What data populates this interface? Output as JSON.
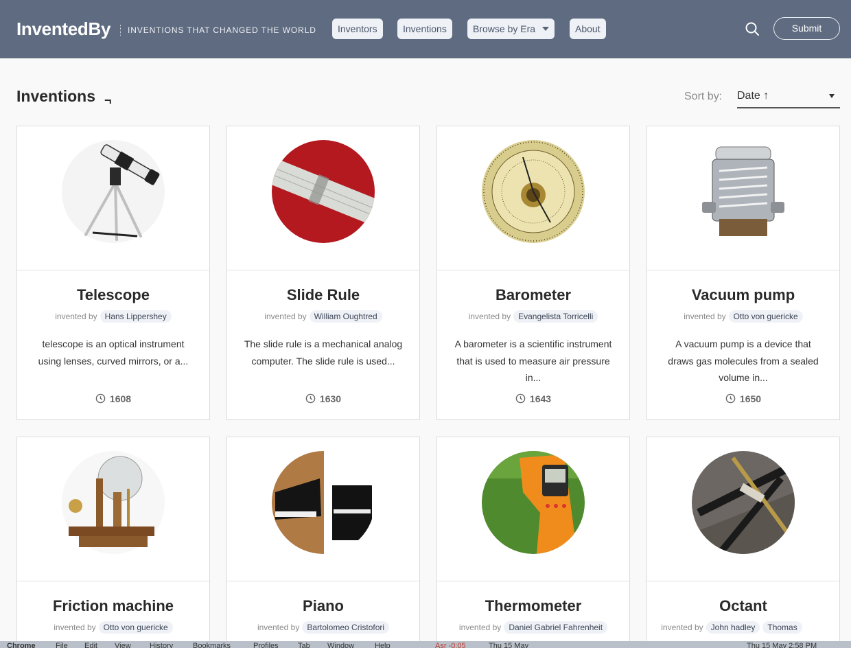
{
  "header": {
    "logo": "InventedBy",
    "tagline": "INVENTIONS THAT CHANGED THE WORLD",
    "nav": [
      "Inventors",
      "Inventions",
      "Browse by Era",
      "About"
    ],
    "search_icon": "search-icon",
    "submit_label": "Submit"
  },
  "main": {
    "title": "Inventions",
    "title_glyph": "¬",
    "sort_label": "Sort by:",
    "sort_value": "Date ↑"
  },
  "cards": [
    {
      "name": "Telescope",
      "by_label": "invented by",
      "inventors": [
        "Hans Lippershey"
      ],
      "desc": "telescope is an optical instrument using lenses, curved mirrors, or a...",
      "year": "1608",
      "image": "telescope-image"
    },
    {
      "name": "Slide Rule",
      "by_label": "invented by",
      "inventors": [
        "William Oughtred"
      ],
      "desc": "The slide rule is a mechanical analog computer. The slide rule is used...",
      "year": "1630",
      "image": "slide-rule-image"
    },
    {
      "name": "Barometer",
      "by_label": "invented by",
      "inventors": [
        "Evangelista Torricelli"
      ],
      "desc": "A barometer is a scientific instrument that is used to measure air pressure in...",
      "year": "1643",
      "image": "barometer-image"
    },
    {
      "name": "Vacuum pump",
      "by_label": "invented by",
      "inventors": [
        "Otto von guericke"
      ],
      "desc": "A vacuum pump is a device that draws gas molecules from a sealed volume in...",
      "year": "1650",
      "image": "vacuum-pump-image"
    },
    {
      "name": "Friction machine",
      "by_label": "invented by",
      "inventors": [
        "Otto von guericke"
      ],
      "image": "friction-machine-image"
    },
    {
      "name": "Piano",
      "by_label": "invented by",
      "inventors": [
        "Bartolomeo Cristofori"
      ],
      "image": "piano-image"
    },
    {
      "name": "Thermometer",
      "by_label": "invented by",
      "inventors": [
        "Daniel Gabriel Fahrenheit"
      ],
      "image": "thermometer-image"
    },
    {
      "name": "Octant",
      "by_label": "invented by",
      "inventors": [
        "John hadley",
        "Thomas"
      ],
      "image": "octant-image"
    }
  ],
  "os_menubar": {
    "items": [
      "Chrome",
      "File",
      "Edit",
      "View",
      "History",
      "Bookmarks",
      "Profiles",
      "Tab",
      "Window",
      "Help"
    ],
    "status": "Asr -0:05",
    "date_badge": "Thu 15 May",
    "clock": "Thu 15 May  2:58 PM"
  },
  "colors": {
    "header_bg": "#5f6b80",
    "chip_bg": "#eef1f6",
    "card_border": "#dcdcdc"
  }
}
